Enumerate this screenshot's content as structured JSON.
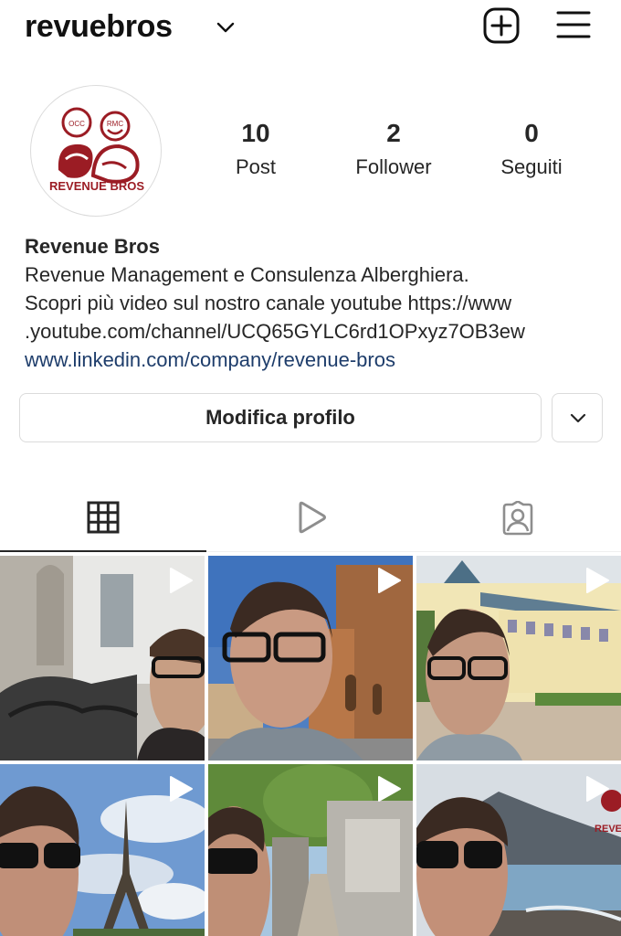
{
  "header": {
    "username": "revuebros"
  },
  "profile": {
    "avatar_lettering": [
      "OCC",
      "RMC",
      "REVENUE BROS"
    ],
    "stats": [
      {
        "value": "10",
        "label": "Post"
      },
      {
        "value": "2",
        "label": "Follower"
      },
      {
        "value": "0",
        "label": "Seguiti"
      }
    ],
    "name": "Revenue Bros",
    "bio_lines": [
      "Revenue Management e Consulenza Alberghiera.",
      "Scopri più video sul nostro canale youtube https://www",
      ".youtube.com/channel/UCQ65GYLC6rd1OPxyz7OB3ew"
    ],
    "website": "www.linkedin.com/company/revenue-bros"
  },
  "actions": {
    "edit_profile": "Modifica profilo"
  },
  "tabs": [
    {
      "icon": "grid-icon",
      "active": true
    },
    {
      "icon": "reels-play-icon",
      "active": false
    },
    {
      "icon": "tagged-person-icon",
      "active": false
    }
  ],
  "posts": [
    {
      "type": "video",
      "scene": "selfie-statue-balcony"
    },
    {
      "type": "video",
      "scene": "selfie-brick-tower"
    },
    {
      "type": "video",
      "scene": "selfie-hotel"
    },
    {
      "type": "video",
      "scene": "selfie-eiffel-tower"
    },
    {
      "type": "video",
      "scene": "selfie-cemetery-path"
    },
    {
      "type": "video",
      "scene": "selfie-lake-mountains"
    }
  ],
  "colors": {
    "link": "#1e3d6b",
    "text": "#262626",
    "border": "#dbdbdb",
    "brand_red": "#9b1c24"
  }
}
